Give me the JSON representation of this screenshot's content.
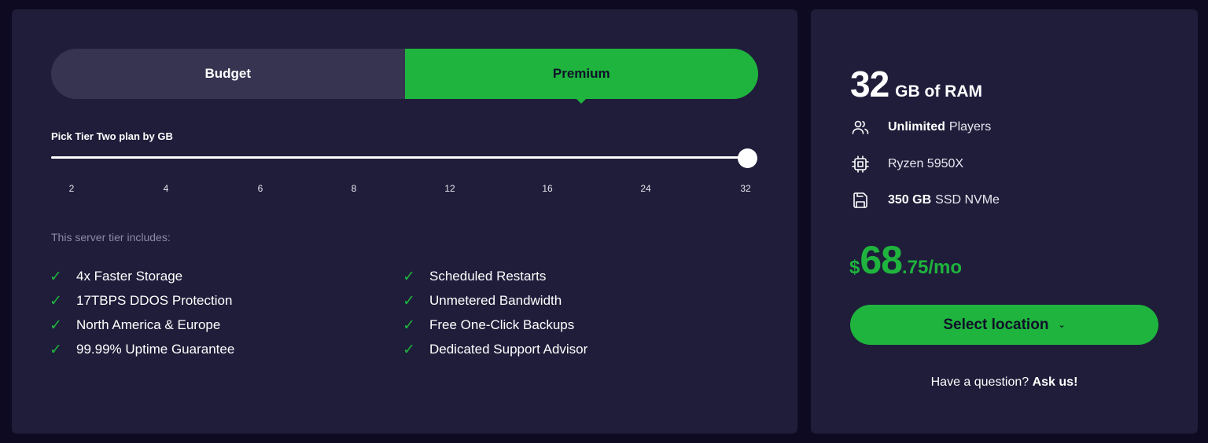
{
  "toggle": {
    "budget_label": "Budget",
    "premium_label": "Premium",
    "selected": "Premium"
  },
  "slider": {
    "label": "Pick Tier Two plan by GB",
    "ticks": [
      "2",
      "4",
      "6",
      "8",
      "12",
      "16",
      "24",
      "32"
    ],
    "selected_value": "32"
  },
  "includes": {
    "title": "This server tier includes:",
    "features": [
      "4x Faster Storage",
      "Scheduled Restarts",
      "17TBPS DDOS Protection",
      "Unmetered Bandwidth",
      "North America & Europe",
      "Free One-Click Backups",
      "99.99% Uptime Guarantee",
      "Dedicated Support Advisor"
    ]
  },
  "summary": {
    "ram_value": "32",
    "ram_unit": "GB of RAM",
    "players_bold": "Unlimited",
    "players_text": "Players",
    "cpu_text": "Ryzen 5950X",
    "storage_bold": "350 GB",
    "storage_text": "SSD NVMe",
    "price_currency": "$",
    "price_integer": "68",
    "price_decimal": ".75/mo",
    "select_label": "Select location",
    "question_text": "Have a question?",
    "ask_label": "Ask us!"
  },
  "colors": {
    "accent": "#1fb43d",
    "panel": "#1f1d3a",
    "background": "#0d0a22"
  },
  "icons": {
    "check": "check-icon",
    "players": "users-icon",
    "cpu": "cpu-icon",
    "storage": "save-icon",
    "chevron": "chevron-down-icon"
  }
}
